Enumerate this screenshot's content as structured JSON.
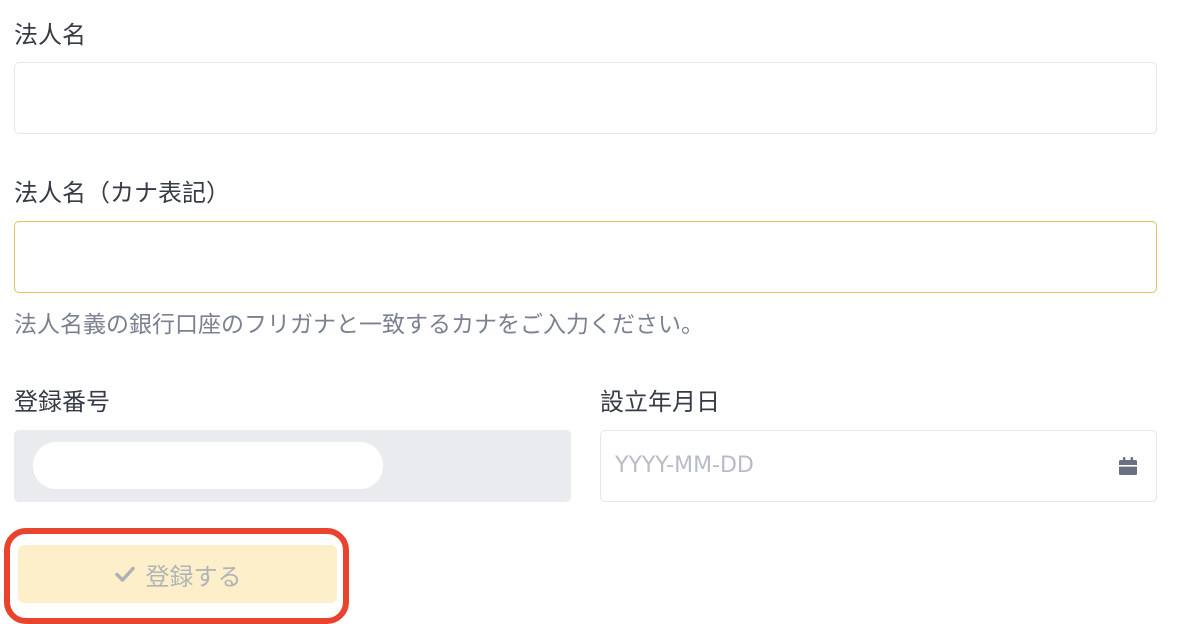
{
  "form": {
    "corporate_name": {
      "label": "法人名",
      "value": ""
    },
    "corporate_name_kana": {
      "label": "法人名（カナ表記）",
      "value": "",
      "help": "法人名義の銀行口座のフリガナと一致するカナをご入力ください。"
    },
    "registration_number": {
      "label": "登録番号"
    },
    "established_date": {
      "label": "設立年月日",
      "placeholder": "YYYY-MM-DD",
      "icon": "calendar-icon"
    },
    "submit": {
      "label": "登録する",
      "icon": "check-icon",
      "state": "disabled"
    }
  },
  "colors": {
    "focus_border": "#e3c15b",
    "button_background": "#fdefc9",
    "highlight_outline": "#e8432c",
    "readonly_background": "#eaebef"
  }
}
